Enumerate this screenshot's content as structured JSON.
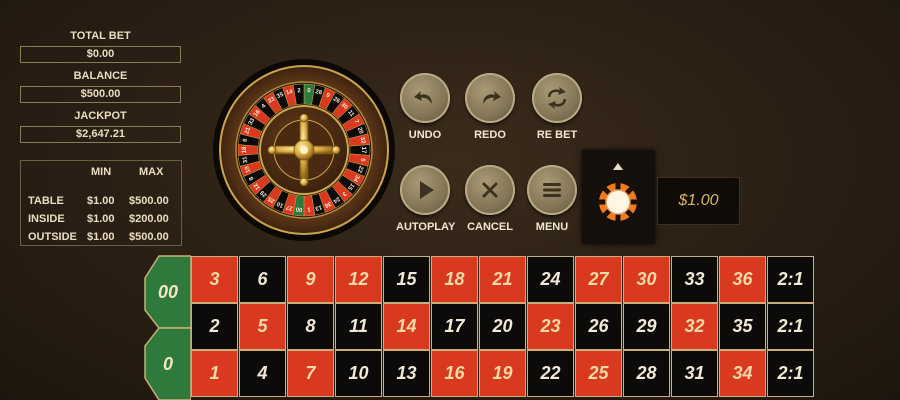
{
  "stats": {
    "total_bet_label": "TOTAL BET",
    "total_bet_value": "$0.00",
    "balance_label": "BALANCE",
    "balance_value": "$500.00",
    "jackpot_label": "JACKPOT",
    "jackpot_value": "$2,647.21"
  },
  "limits": {
    "min_header": "MIN",
    "max_header": "MAX",
    "rows": [
      {
        "label": "TABLE",
        "min": "$1.00",
        "max": "$500.00"
      },
      {
        "label": "INSIDE",
        "min": "$1.00",
        "max": "$200.00"
      },
      {
        "label": "OUTSIDE",
        "min": "$1.00",
        "max": "$500.00"
      }
    ]
  },
  "controls": {
    "undo": "UNDO",
    "redo": "REDO",
    "rebet": "RE BET",
    "autoplay": "AUTOPLAY",
    "cancel": "CANCEL",
    "menu": "MENU"
  },
  "chip": {
    "value": "$1.00",
    "color": "#f07a1c",
    "icon": "chip-icon"
  },
  "table": {
    "zeros": [
      "00",
      "0"
    ],
    "rows": [
      [
        "3",
        "6",
        "9",
        "12",
        "15",
        "18",
        "21",
        "24",
        "27",
        "30",
        "33",
        "36"
      ],
      [
        "2",
        "5",
        "8",
        "11",
        "14",
        "17",
        "20",
        "23",
        "26",
        "29",
        "32",
        "35"
      ],
      [
        "1",
        "4",
        "7",
        "10",
        "13",
        "16",
        "19",
        "22",
        "25",
        "28",
        "31",
        "34"
      ]
    ],
    "column_bet_label": "2:1",
    "red_numbers": [
      "1",
      "3",
      "5",
      "7",
      "9",
      "12",
      "14",
      "16",
      "18",
      "19",
      "21",
      "23",
      "25",
      "27",
      "30",
      "32",
      "34",
      "36"
    ],
    "red_color": "#d93a1f",
    "black_color": "#0c0b0a",
    "felt_color": "#2f7a3a"
  },
  "wheel": {
    "pockets": [
      "0",
      "28",
      "9",
      "26",
      "30",
      "11",
      "7",
      "20",
      "32",
      "17",
      "5",
      "22",
      "34",
      "15",
      "3",
      "24",
      "36",
      "13",
      "1",
      "00",
      "27",
      "10",
      "25",
      "29",
      "12",
      "8",
      "19",
      "31",
      "18",
      "6",
      "21",
      "33",
      "16",
      "4",
      "23",
      "35",
      "14",
      "2"
    ]
  }
}
